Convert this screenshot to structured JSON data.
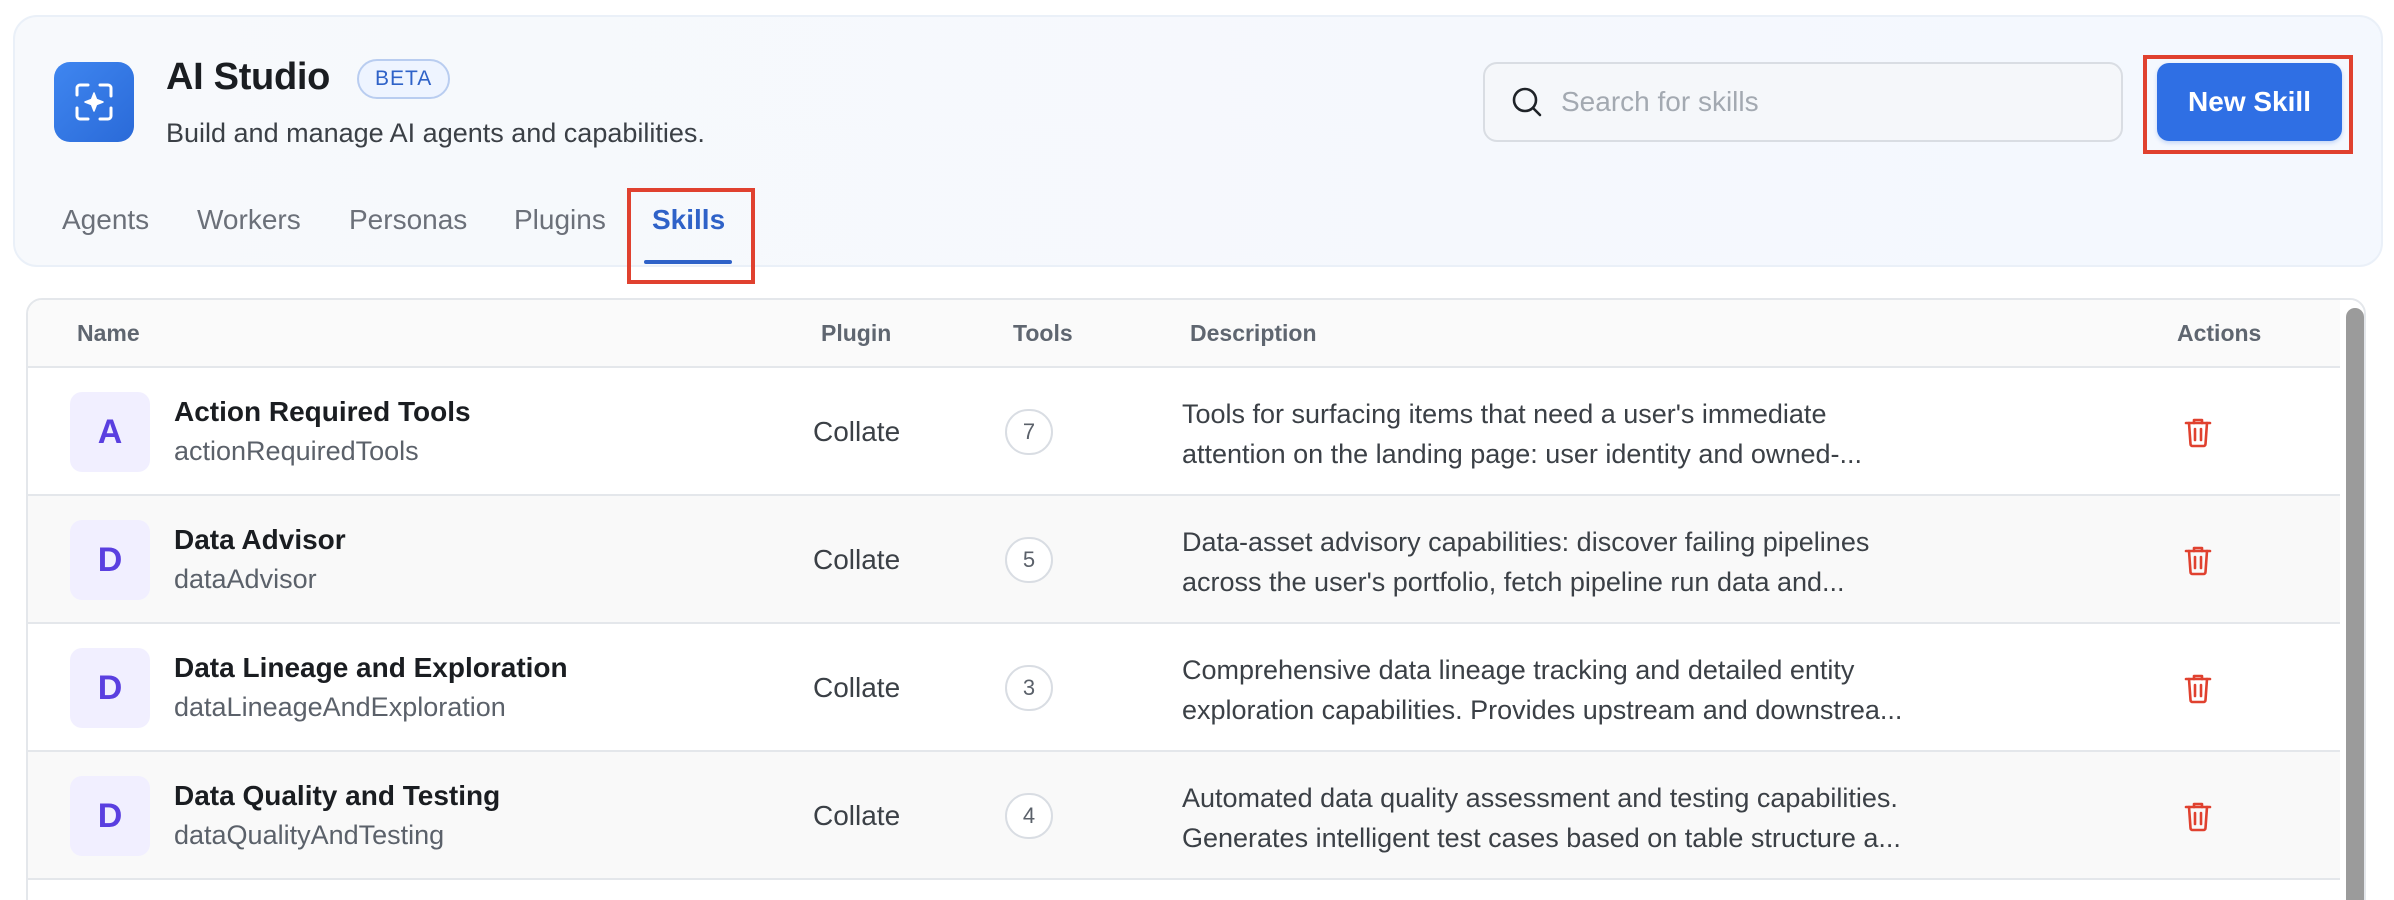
{
  "app": {
    "title": "AI Studio",
    "badge": "BETA",
    "subtitle": "Build and manage AI agents and capabilities.",
    "logo_icon": "sparkle-frame-icon",
    "accent_color": "#2f6fe4"
  },
  "search": {
    "placeholder": "Search for skills",
    "value": ""
  },
  "actions": {
    "new_skill_label": "New Skill"
  },
  "tabs": [
    {
      "label": "Agents",
      "active": false
    },
    {
      "label": "Workers",
      "active": false
    },
    {
      "label": "Personas",
      "active": false
    },
    {
      "label": "Plugins",
      "active": false
    },
    {
      "label": "Skills",
      "active": true
    }
  ],
  "table": {
    "columns": [
      "Name",
      "Plugin",
      "Tools",
      "Description",
      "Actions"
    ],
    "rows": [
      {
        "initial": "A",
        "name": "Action Required Tools",
        "id": "actionRequiredTools",
        "plugin": "Collate",
        "tools": "7",
        "desc_line1": "Tools for surfacing items that need a user's immediate",
        "desc_line2": "attention on the landing page: user identity and owned-...",
        "action_icon": "trash-icon"
      },
      {
        "initial": "D",
        "name": "Data Advisor",
        "id": "dataAdvisor",
        "plugin": "Collate",
        "tools": "5",
        "desc_line1": "Data-asset advisory capabilities: discover failing pipelines",
        "desc_line2": "across the user's portfolio, fetch pipeline run data and...",
        "action_icon": "trash-icon"
      },
      {
        "initial": "D",
        "name": "Data Lineage and Exploration",
        "id": "dataLineageAndExploration",
        "plugin": "Collate",
        "tools": "3",
        "desc_line1": "Comprehensive data lineage tracking and detailed entity",
        "desc_line2": "exploration capabilities. Provides upstream and downstrea...",
        "action_icon": "trash-icon"
      },
      {
        "initial": "D",
        "name": "Data Quality and Testing",
        "id": "dataQualityAndTesting",
        "plugin": "Collate",
        "tools": "4",
        "desc_line1": "Automated data quality assessment and testing capabilities.",
        "desc_line2": "Generates intelligent test cases based on table structure a...",
        "action_icon": "trash-icon"
      }
    ]
  }
}
